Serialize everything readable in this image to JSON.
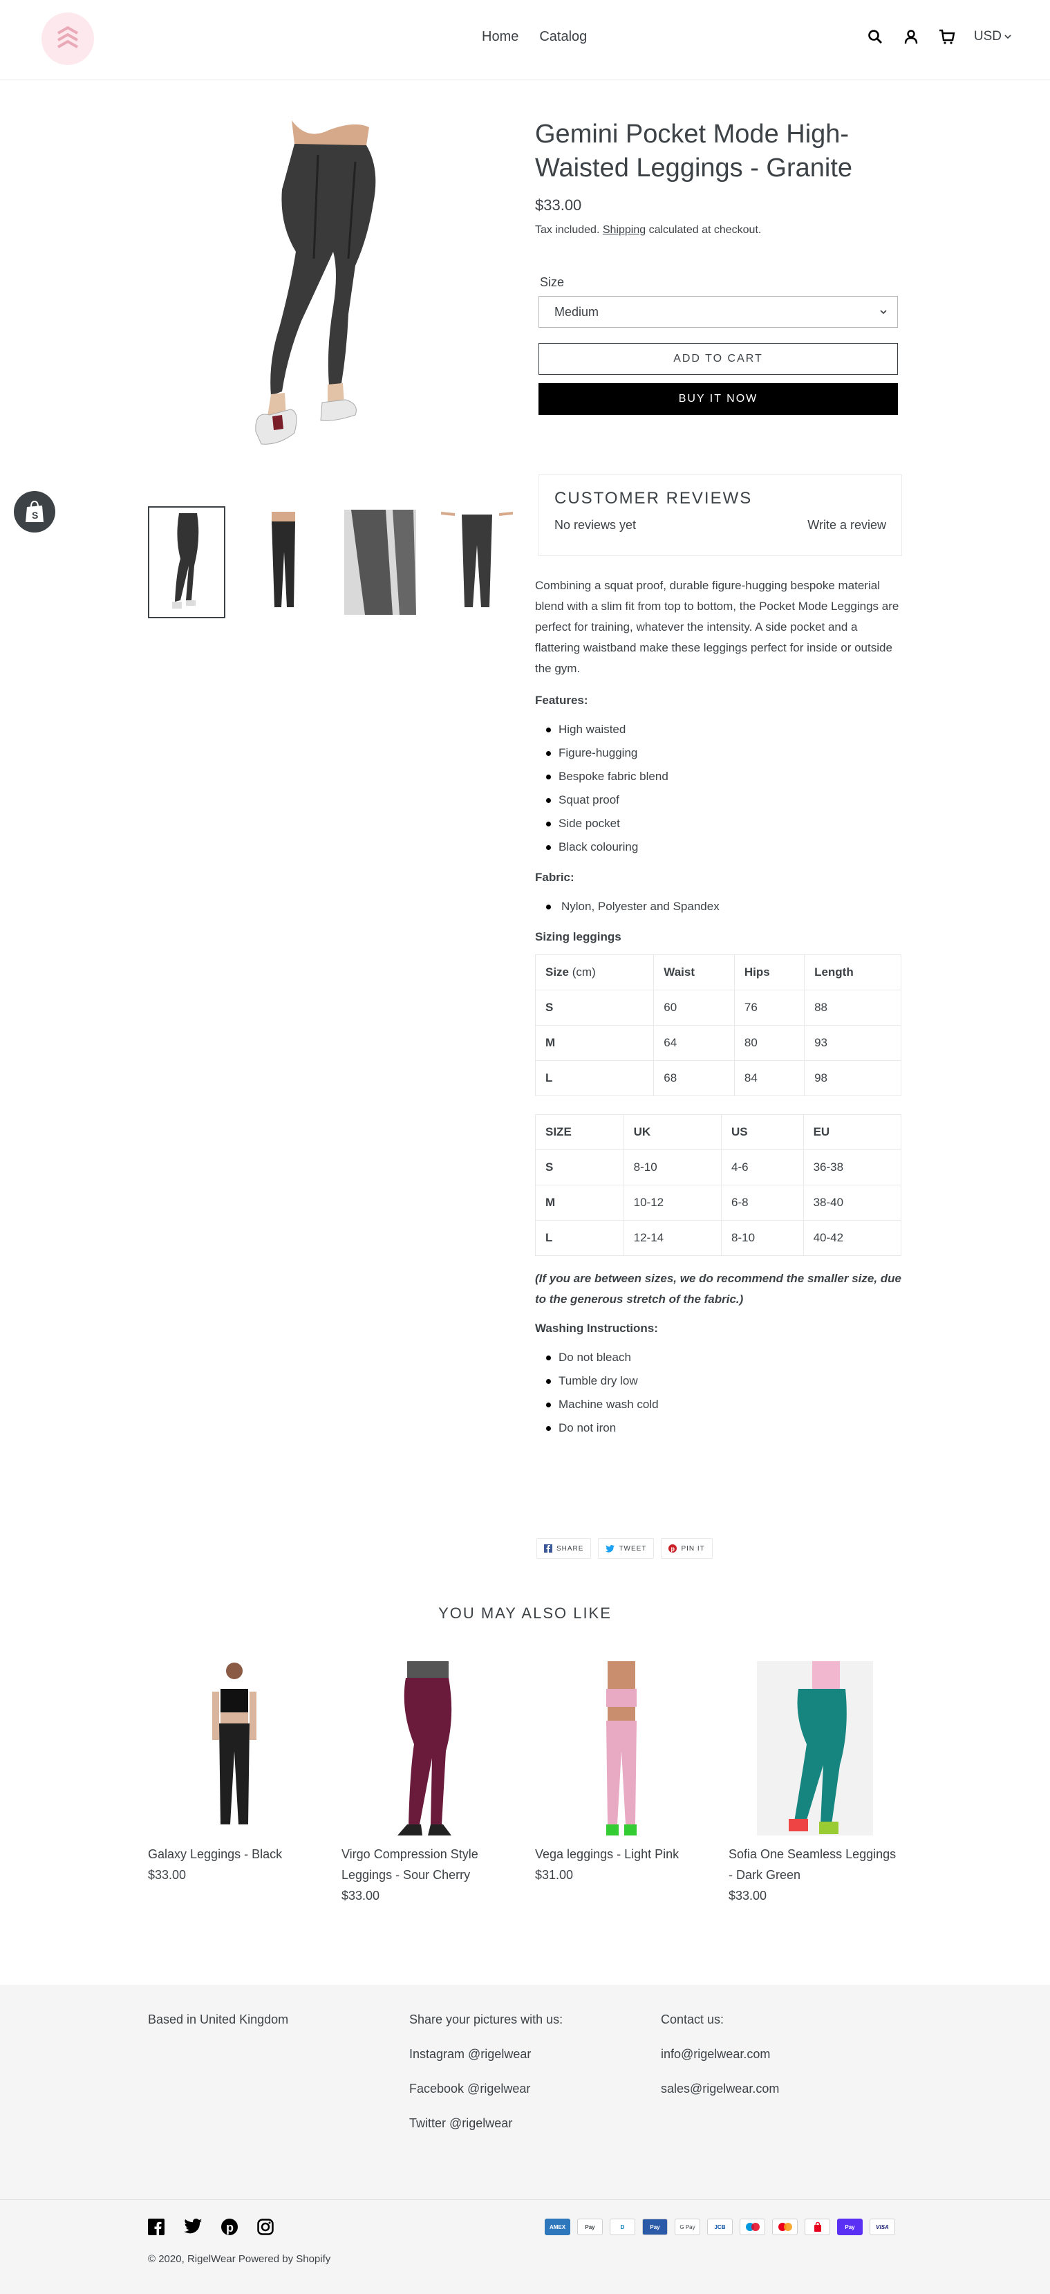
{
  "header": {
    "nav": [
      "Home",
      "Catalog"
    ],
    "currency": "USD"
  },
  "product": {
    "title": "Gemini Pocket Mode High-Waisted Leggings - Granite",
    "price": "$33.00",
    "tax_prefix": "Tax included.",
    "tax_link": "Shipping",
    "tax_suffix": "calculated at checkout.",
    "size_label": "Size",
    "size_value": "Medium",
    "add_to_cart": "ADD TO CART",
    "buy_now": "BUY IT NOW"
  },
  "reviews": {
    "title": "CUSTOMER REVIEWS",
    "none": "No reviews yet",
    "write": "Write a review"
  },
  "description": {
    "intro": "Combining a squat proof, durable figure-hugging bespoke material blend with a slim fit from top to bottom, the Pocket Mode Leggings are perfect for training, whatever the intensity. A side pocket and a flattering waistband make these leggings perfect for inside or outside the gym.",
    "features_title": "Features:",
    "features": [
      "High waisted",
      "Figure-hugging",
      "Bespoke fabric blend",
      "Squat proof",
      "Side pocket",
      "Black colouring"
    ],
    "fabric_title": "Fabric:",
    "fabric": [
      "Nylon, Polyester and Spandex"
    ],
    "sizing_title": "Sizing leggings",
    "table1": {
      "header": [
        "Size",
        "(cm)",
        "Waist",
        "Hips",
        "Length"
      ],
      "rows": [
        [
          "S",
          "60",
          "76",
          "88"
        ],
        [
          "M",
          "64",
          "80",
          "93"
        ],
        [
          "L",
          "68",
          "84",
          "98"
        ]
      ]
    },
    "table2": {
      "header": [
        "SIZE",
        "UK",
        "US",
        "EU"
      ],
      "rows": [
        [
          "S",
          "8-10",
          "4-6",
          "36-38"
        ],
        [
          "M",
          "10-12",
          "6-8",
          "38-40"
        ],
        [
          "L",
          "12-14",
          "8-10",
          "40-42"
        ]
      ]
    },
    "note": "(If you are between sizes, we do recommend the smaller size, due to the generous stretch of the fabric.)",
    "washing_title": "Washing Instructions:",
    "washing": [
      "Do not bleach",
      "Tumble dry low",
      "Machine wash cold",
      "Do not iron"
    ]
  },
  "share": {
    "share": "SHARE",
    "tweet": "TWEET",
    "pin": "PIN IT"
  },
  "related": {
    "title": "YOU MAY ALSO LIKE",
    "items": [
      {
        "name": "Galaxy Leggings - Black",
        "price": "$33.00",
        "color": "#1f1f1f"
      },
      {
        "name": "Virgo Compression Style Leggings - Sour Cherry",
        "price": "$33.00",
        "color": "#6a1a3a"
      },
      {
        "name": "Vega leggings - Light Pink",
        "price": "$31.00",
        "color": "#e7aac2"
      },
      {
        "name": "Sofia One Seamless Leggings - Dark Green",
        "price": "$33.00",
        "color": "#16857f"
      }
    ]
  },
  "footer": {
    "based": "Based in United Kingdom",
    "share_title": "Share your pictures with us:",
    "instagram": "Instagram @rigelwear",
    "facebook": "Facebook @rigelwear",
    "twitter": "Twitter @rigelwear",
    "contact_title": "Contact us:",
    "email1": "info@rigelwear.com",
    "email2": "sales@rigelwear.com",
    "copyright_prefix": "© 2020,",
    "brand": "RigelWear",
    "powered": "Powered by Shopify",
    "payments": [
      "AMEX",
      "Pay",
      "D",
      "Pay",
      "G Pay",
      "JCB",
      "MC",
      "MC",
      "SP",
      "Pay",
      "VISA"
    ]
  }
}
